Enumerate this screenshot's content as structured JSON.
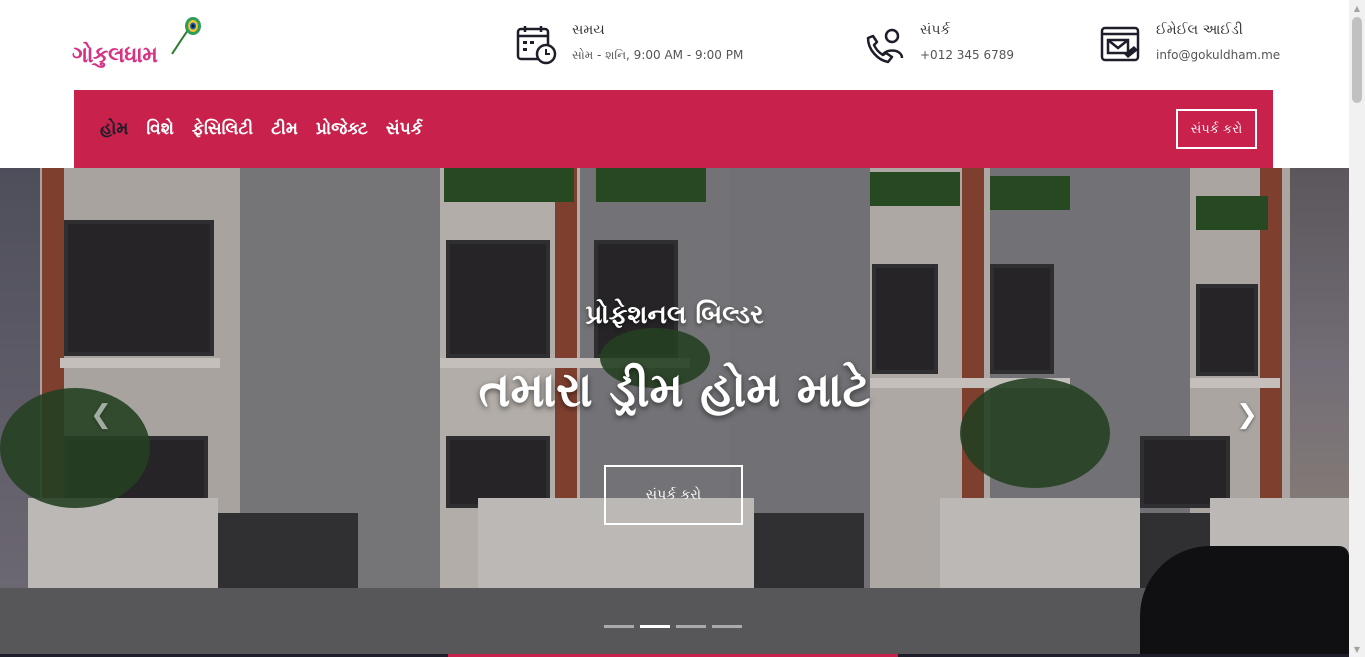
{
  "brand": {
    "logo_text": "ગોકુલધામ",
    "logo_icon": "peacock-feather-icon",
    "logo_color": "#d63384"
  },
  "contact_info": [
    {
      "icon": "calendar-clock-icon",
      "title": "સમય",
      "text": "સોમ - શનિ, 9:00 AM - 9:00 PM"
    },
    {
      "icon": "phone-support-icon",
      "title": "સંપર્ક",
      "text": "+012 345 6789"
    },
    {
      "icon": "email-icon",
      "title": "ઈમેઈલ આઈડી",
      "text": "info@gokuldham.me"
    }
  ],
  "nav": {
    "items": [
      {
        "label": "હોમ",
        "active": true
      },
      {
        "label": "વિશે",
        "active": false
      },
      {
        "label": "ફેસિલિટી",
        "active": false
      },
      {
        "label": "ટીમ",
        "active": false
      },
      {
        "label": "પ્રોજેક્ટ",
        "active": false
      },
      {
        "label": "સંપર્ક",
        "active": false
      }
    ],
    "cta_label": "સંપર્ક કરો",
    "background": "#c8214b",
    "active_color": "#1e1e2a"
  },
  "hero": {
    "subtitle": "પ્રોફેશનલ બિલ્ડર",
    "title": "તમારા ડ્રીમ હોમ માટે",
    "cta_label": "સંપર્ક કરો",
    "prev_icon": "chevron-left-icon",
    "next_icon": "chevron-right-icon",
    "slides_count": 4,
    "active_slide": 2
  },
  "colors": {
    "accent": "#c8214b",
    "dark": "#1e1e2a"
  }
}
